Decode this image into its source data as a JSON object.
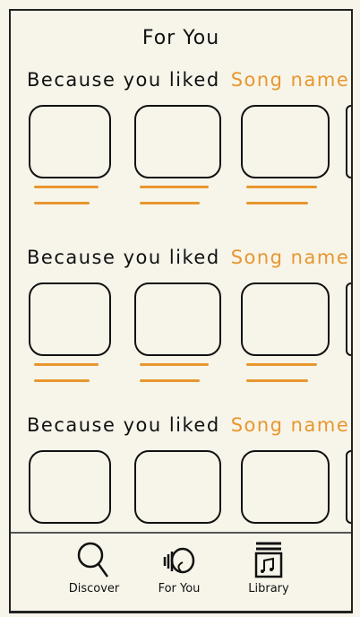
{
  "header": {
    "title": "For You"
  },
  "sections": [
    {
      "prefix": "Because you liked",
      "song": "Song name ...."
    },
    {
      "prefix": "Because you liked",
      "song": "Song name ...."
    },
    {
      "prefix": "Because you liked",
      "song": "Song name ...."
    }
  ],
  "nav": [
    {
      "label": "Discover",
      "icon": "search-icon"
    },
    {
      "label": "For You",
      "icon": "headphones-icon"
    },
    {
      "label": "Library",
      "icon": "music-library-icon"
    }
  ],
  "colors": {
    "accent": "#e8962e",
    "ink": "#111111",
    "paper": "#f7f5ea"
  }
}
